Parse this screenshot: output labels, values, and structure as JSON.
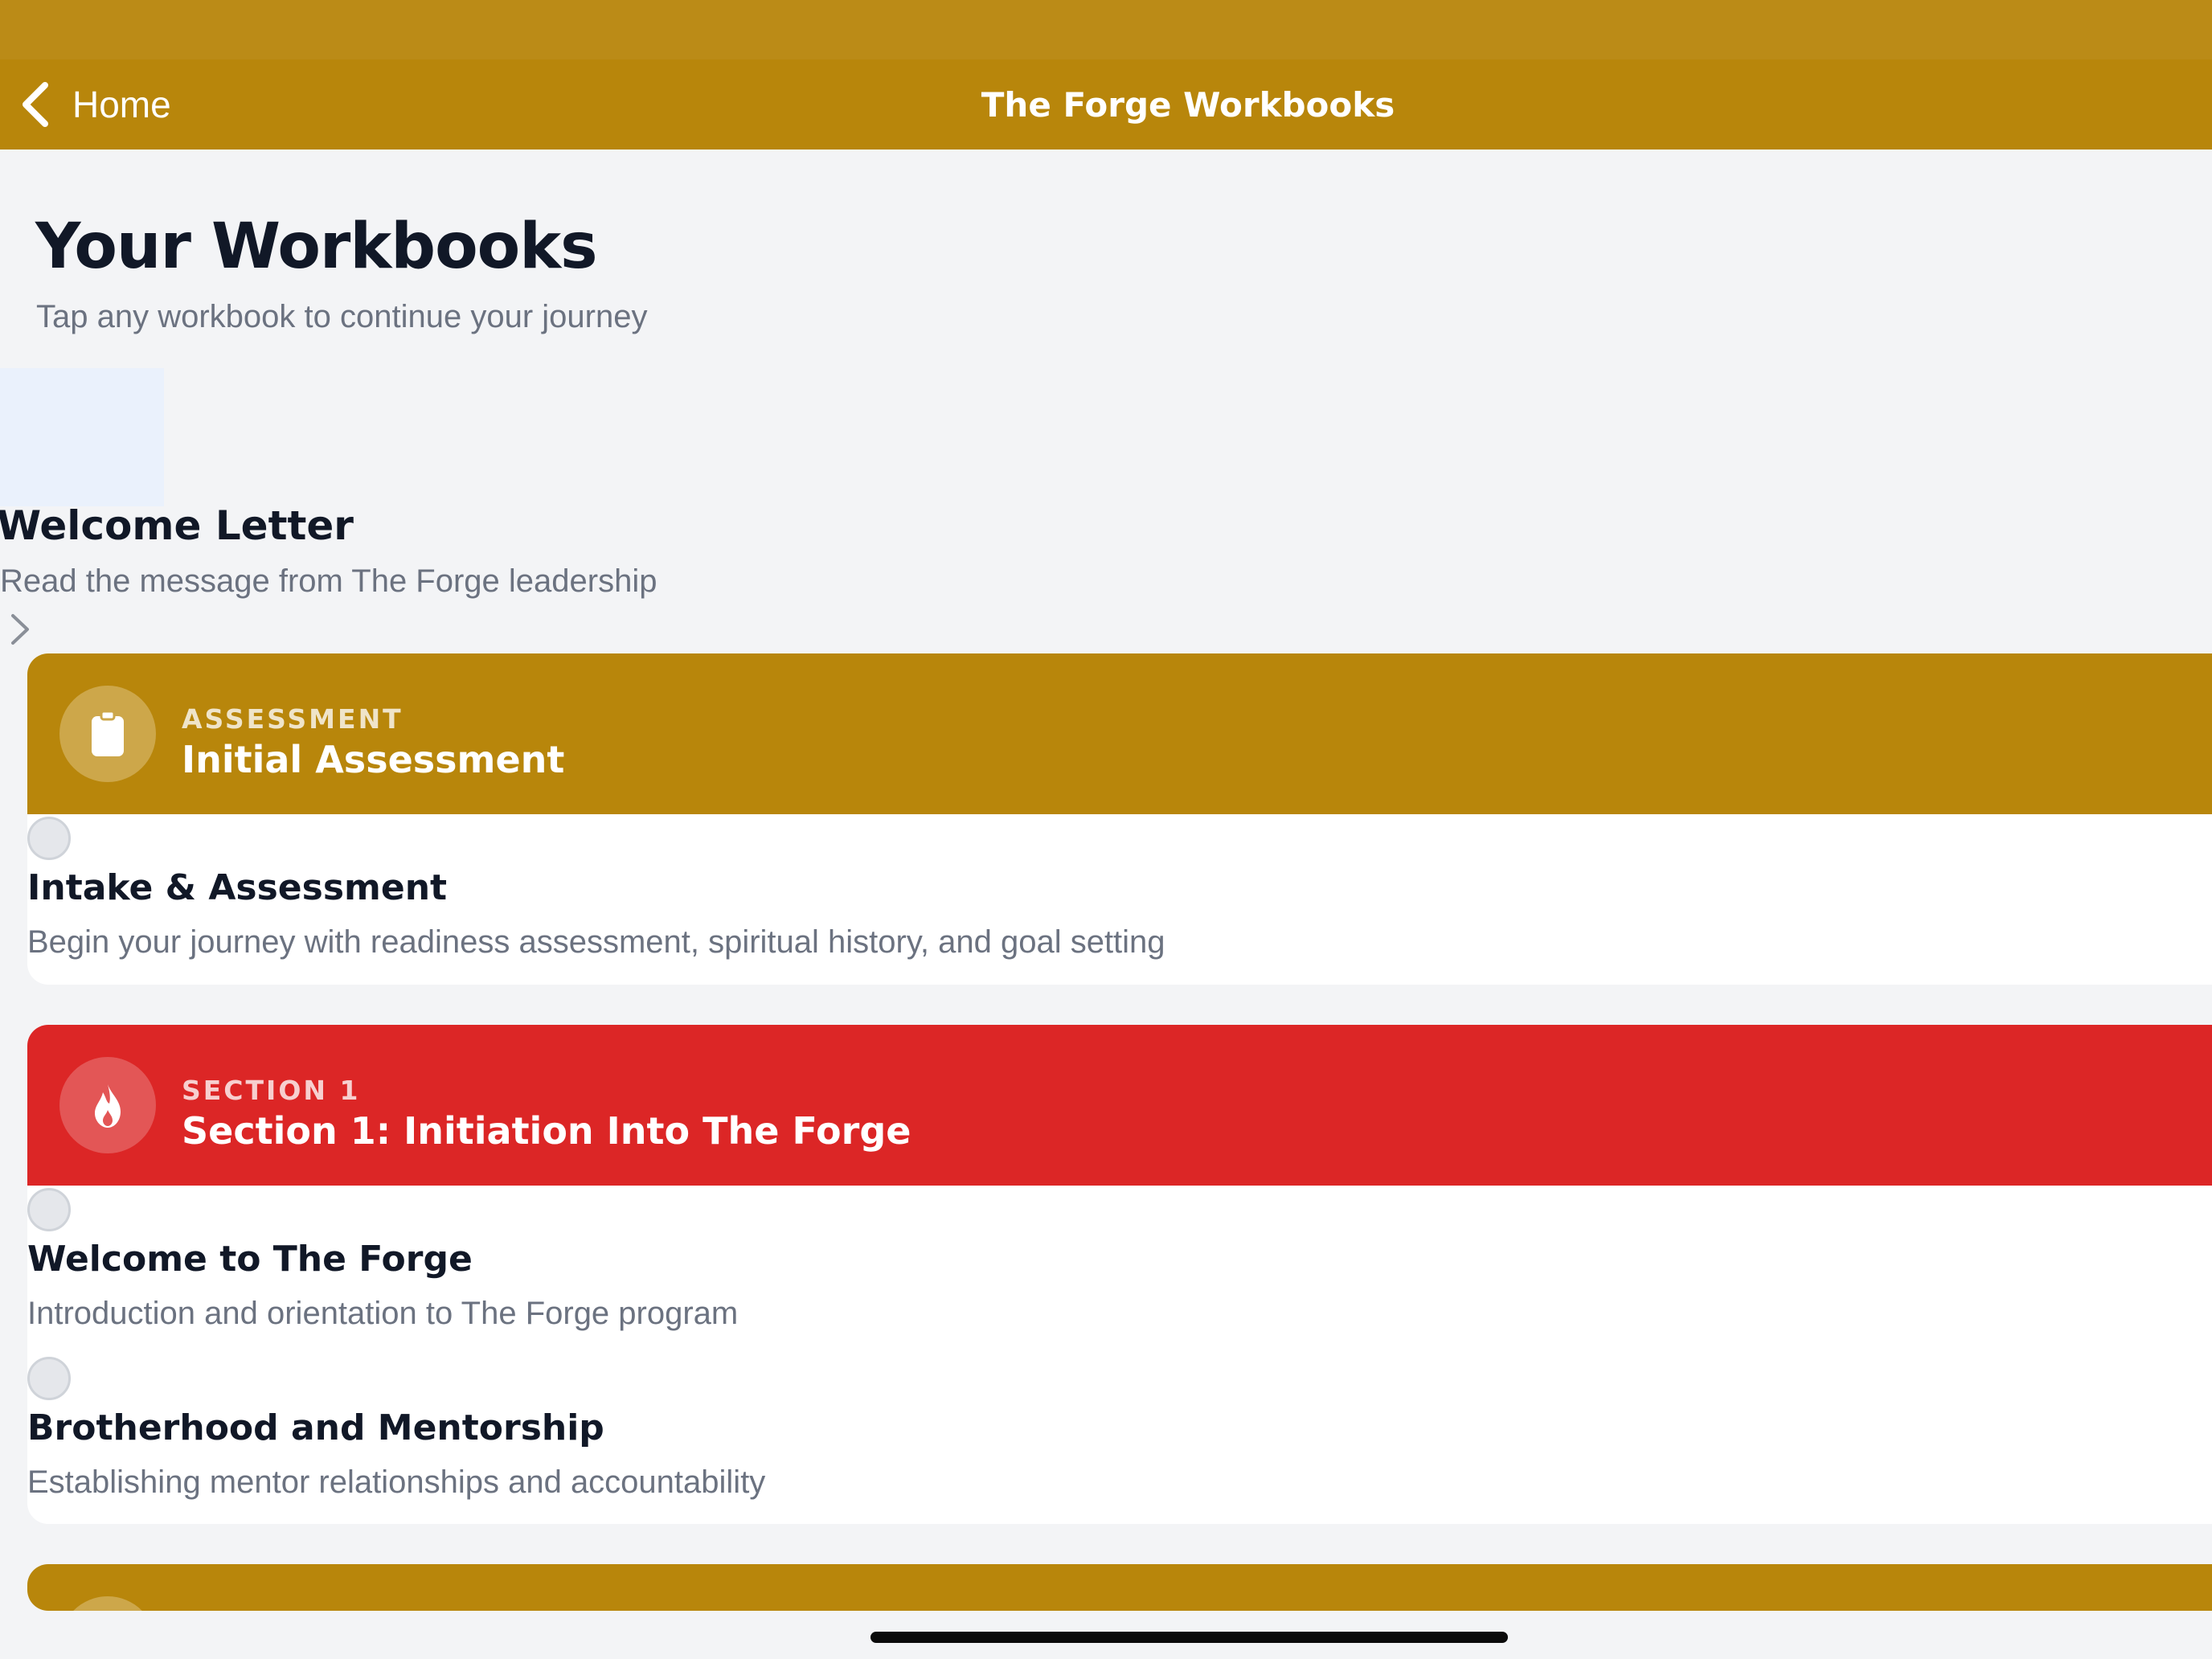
{
  "nav": {
    "back_label": "Home",
    "title": "The Forge Workbooks"
  },
  "header": {
    "title": "Your Workbooks",
    "subtitle": "Tap any workbook to continue your journey"
  },
  "welcome": {
    "title": "Welcome Letter",
    "description": "Read the message from The Forge leadership"
  },
  "sections": [
    {
      "eyebrow": "ASSESSMENT",
      "title": "Initial Assessment",
      "color": "#b8860b",
      "icon_bg": "#cda74a",
      "icon": "clipboard-icon",
      "items": [
        {
          "title": "Intake & Assessment",
          "description": "Begin your journey with readiness assessment, spiritual history, and goal setting"
        }
      ]
    },
    {
      "eyebrow": "SECTION 1",
      "title": "Section 1: Initiation Into The Forge",
      "color": "#dc2626",
      "icon_bg": "#e35656",
      "icon": "flame-icon",
      "items": [
        {
          "title": "Welcome to The Forge",
          "description": "Introduction and orientation to The Forge program"
        },
        {
          "title": "Brotherhood and Mentorship",
          "description": "Establishing mentor relationships and accountability"
        }
      ]
    }
  ],
  "colors": {
    "nav_bar": "#b8860b",
    "background": "#f3f4f6",
    "title_text": "#111827",
    "muted_text": "#6b7280"
  }
}
